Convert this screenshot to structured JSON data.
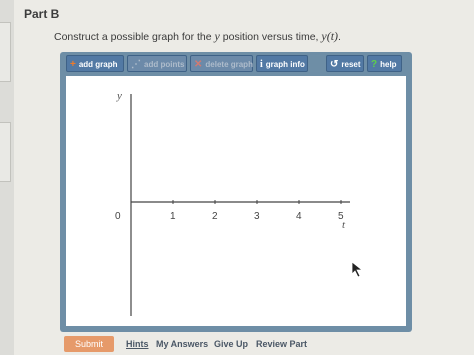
{
  "part": {
    "title": "Part B"
  },
  "instruction": {
    "pre": "Construct a possible graph for the ",
    "var_y": "y",
    "mid": " position versus time, ",
    "func": "y(t)",
    "post": "."
  },
  "toolbar": {
    "add_graph": "add graph",
    "add_points": "add points",
    "delete_graph": "delete graph",
    "graph_info": "graph info",
    "reset": "reset",
    "help": "help"
  },
  "graph": {
    "y_axis_label": "y",
    "x_axis_label": "t",
    "x_ticks": [
      "0",
      "1",
      "2",
      "3",
      "4",
      "5"
    ]
  },
  "footer": {
    "submit": "Submit",
    "hints": "Hints",
    "my_answers": "My Answers",
    "give_up": "Give Up",
    "review_part": "Review Part"
  }
}
